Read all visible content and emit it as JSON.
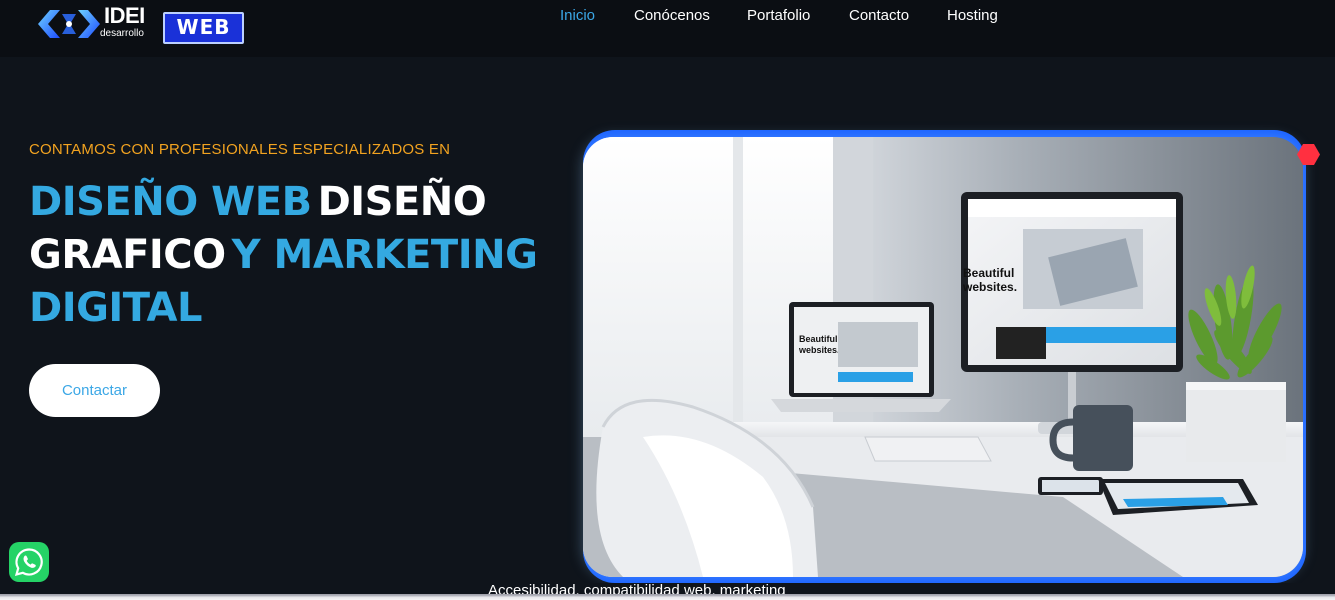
{
  "brand": {
    "logo_main": "IDEI",
    "logo_sub": "desarrollo",
    "logo_badge": "WEB"
  },
  "nav": {
    "items": [
      {
        "label": "Inicio",
        "active": true
      },
      {
        "label": "Conócenos",
        "active": false
      },
      {
        "label": "Portafolio",
        "active": false
      },
      {
        "label": "Contacto",
        "active": false
      },
      {
        "label": "Hosting",
        "active": false
      }
    ]
  },
  "hero": {
    "eyebrow": "CONTAMOS CON PROFESIONALES ESPECIALIZADOS EN",
    "headline": {
      "part1": "DISEÑO WEB",
      "part2": "DISEÑO",
      "part3": "GRAFICO",
      "part4": "Y MARKETING",
      "part5": "DIGITAL"
    },
    "cta_label": "Contactar",
    "image_text": {
      "desktop_title": "Beautiful websites.",
      "laptop_title": "Beautiful websites."
    }
  },
  "footer": {
    "cut_text": "Accesibilidad, compatibilidad web, marketing"
  },
  "colors": {
    "background": "#0f141b",
    "navbar": "#0b0e13",
    "accent_blue": "#34a9e1",
    "eyebrow_orange": "#f2a320",
    "frame_blue": "#1a62ff",
    "logo_badge": "#1a31d8",
    "whatsapp_green": "#25d366",
    "hexagon_red": "#ff3040"
  },
  "icons": {
    "logo_mark": "idei-arrow-logo-icon",
    "whatsapp": "whatsapp-icon",
    "decoration": "hexagon-icon"
  }
}
